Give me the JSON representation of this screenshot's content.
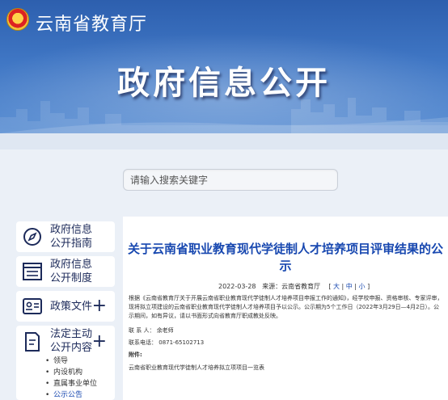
{
  "header": {
    "site_name": "云南省教育厅",
    "banner_title": "政府信息公开"
  },
  "search": {
    "placeholder": "请输入搜索关键字"
  },
  "sidebar": {
    "items": [
      {
        "label_line1": "政府信息",
        "label_line2": "公开指南",
        "icon": "compass-icon"
      },
      {
        "label_line1": "政府信息",
        "label_line2": "公开制度",
        "icon": "document-list-icon"
      },
      {
        "label_line1": "政策文件",
        "icon": "id-card-icon",
        "expand": "+"
      },
      {
        "label_line1": "法定主动",
        "label_line2": "公开内容",
        "icon": "edit-document-icon",
        "expand": "+"
      }
    ],
    "sub_items": [
      "领导",
      "内设机构",
      "直属事业单位",
      "公示公告"
    ]
  },
  "article": {
    "title": "关于云南省职业教育现代学徒制人才培养项目评审结果的公示",
    "date": "2022-03-28",
    "source_label": "来源：云南省教育厅",
    "font_size_label_open": "[",
    "font_large": "大",
    "font_medium": "中",
    "font_small": "小",
    "font_size_label_close": "]",
    "body": "根据《云南省教育厅关于开展云南省职业教育现代学徒制人才培养项目申报工作的通知》，经学校申报、资格审核、专家评审，现将拟立项建设的云南省职业教育现代学徒制人才培养项目予以公示。公示期为5个工作日（2022年3月29日—4月2日）。公示期间，如有异议，请以书面形式向省教育厅职成教处反映。",
    "contact_label": "联 系 人：",
    "contact_value": "余老师",
    "phone_label": "联系电话：",
    "phone_value": "0871-65102713",
    "attachment_label": "附件:",
    "attachment_name": "云南省职业教育现代学徒制人才培养拟立项项目一览表"
  },
  "colors": {
    "banner": "#3f76c4",
    "title_blue": "#1848b0",
    "sidebar_text": "#1c2a5a",
    "page_bg": "#ebf0f7"
  }
}
